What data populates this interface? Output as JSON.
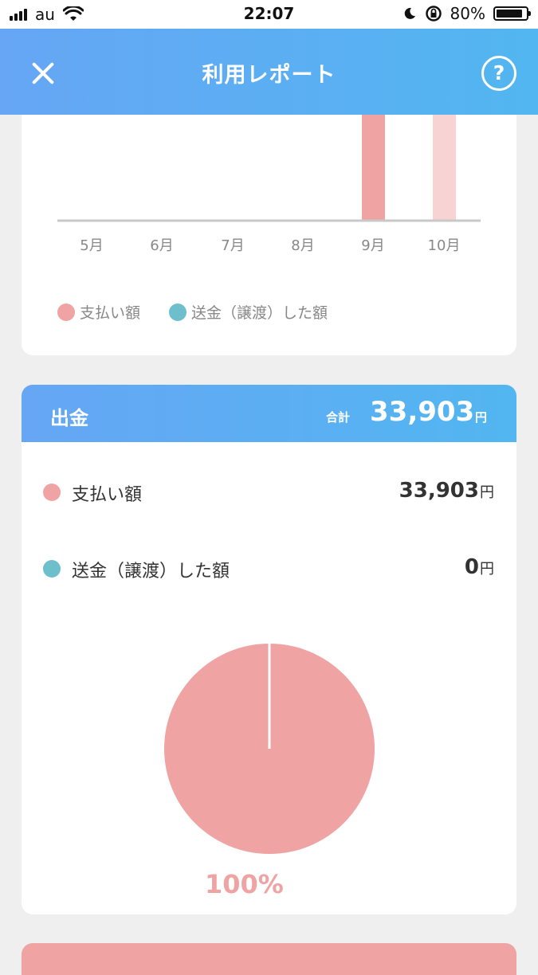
{
  "status_bar": {
    "carrier": "au",
    "time": "22:07",
    "battery": "80%"
  },
  "header": {
    "title": "利用レポート",
    "help_label": "?"
  },
  "bar_chart": {
    "months": [
      "5月",
      "6月",
      "7月",
      "8月",
      "9月",
      "10月"
    ],
    "legend": [
      "支払い額",
      "送金（譲渡）した額"
    ]
  },
  "withdrawal": {
    "title": "出金",
    "total_label": "合計",
    "total": "33,903",
    "total_unit": "円",
    "rows": [
      {
        "label": "支払い額",
        "amount": "33,903",
        "unit": "円"
      },
      {
        "label": "送金（譲渡）した額",
        "amount": "0",
        "unit": "円"
      }
    ],
    "pie_percent": "100%"
  },
  "colors": {
    "payment": "#f0a3a3",
    "transfer": "#6dbfcb",
    "header_gradient_start": "#66a6f5",
    "header_gradient_end": "#52b6f0"
  },
  "chart_data": [
    {
      "type": "bar",
      "categories": [
        "5月",
        "6月",
        "7月",
        "8月",
        "9月",
        "10月"
      ],
      "series": [
        {
          "name": "支払い額",
          "values": [
            0,
            0,
            0,
            0,
            33903,
            33903
          ]
        }
      ]
    },
    {
      "type": "pie",
      "categories": [
        "支払い額",
        "送金（譲渡）した額"
      ],
      "values": [
        33903,
        0
      ],
      "annotations": [
        "100%"
      ]
    }
  ]
}
